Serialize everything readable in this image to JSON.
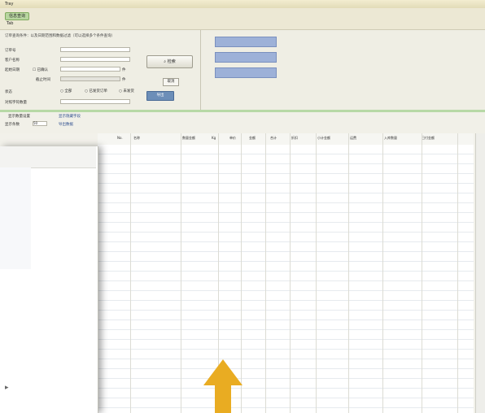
{
  "window": {
    "title": "Tray",
    "menu_tab": "信息查询",
    "menu_sub": "Tab"
  },
  "form": {
    "note": "订单查询条件：以及日期范围和数据过滤（可以选择多个条件查询）",
    "labels": [
      "订单号",
      "客户名称",
      "起始日期",
      "结束日期",
      "状态",
      "对照字符数量"
    ],
    "checkbox_label": "已确认",
    "sub_label": "截止时间",
    "search_label": "检索",
    "small_label": "取消",
    "export_label": "导出",
    "options": [
      "全部",
      "已发货订单",
      "未发货"
    ],
    "units": [
      "件",
      "件",
      "件"
    ]
  },
  "subbar": {
    "label1": "显示数量设置",
    "label2": "显示条数",
    "value": "50",
    "link1": "显示隐藏字段",
    "link2": "导出数据"
  },
  "grid": {
    "columns": [
      "No.",
      "名称",
      "数量金额",
      "Kg",
      "单价",
      "金额",
      "合计",
      "折扣",
      "小计金额",
      "运费",
      "入库数量",
      "已付金额"
    ],
    "row_count": 27
  },
  "annotation": {
    "arrow_color": "#e9ac22"
  }
}
